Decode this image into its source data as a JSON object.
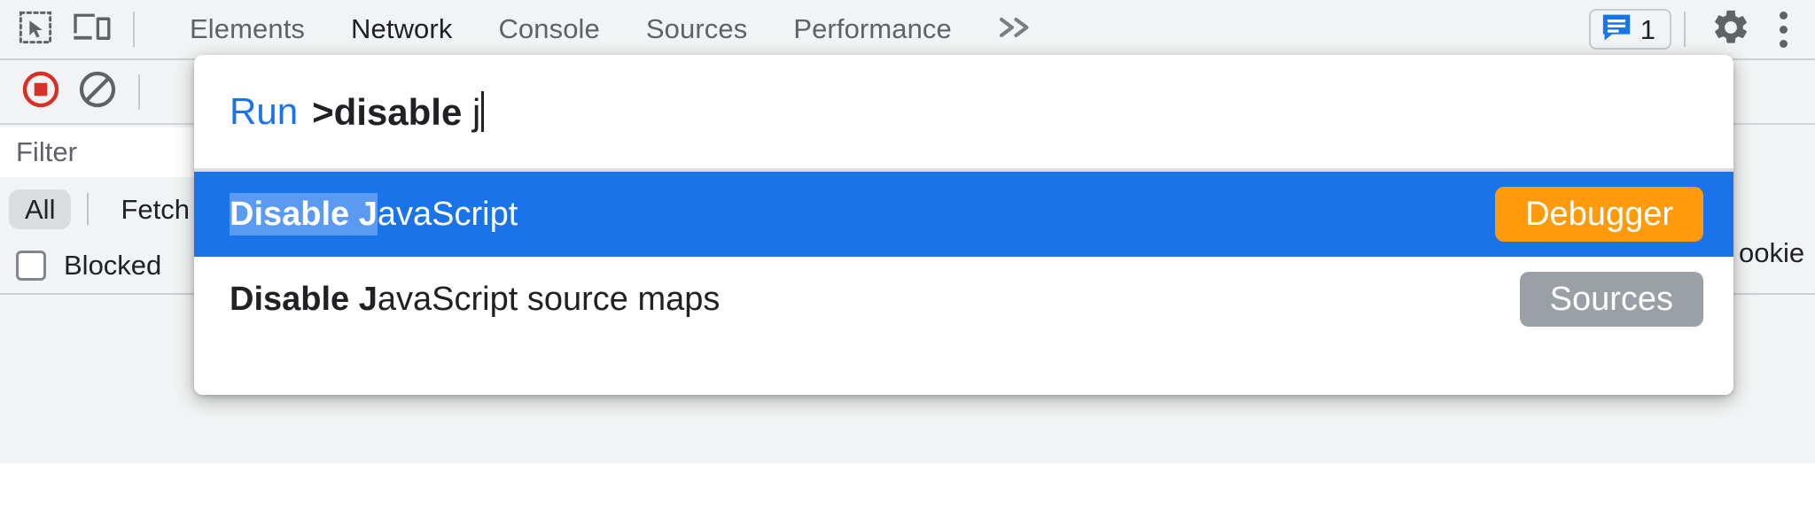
{
  "toolbar": {
    "icons": {
      "inspect": "inspect-element-icon",
      "device": "device-toolbar-icon",
      "overflow": "chevron-double-right-icon",
      "settings": "gear-icon",
      "more": "more-vertical-icon",
      "messages": "message-bubble-icon"
    },
    "tabs": [
      {
        "label": "Elements",
        "active": false
      },
      {
        "label": "Network",
        "active": true
      },
      {
        "label": "Console",
        "active": false
      },
      {
        "label": "Sources",
        "active": false
      },
      {
        "label": "Performance",
        "active": false
      }
    ],
    "overflow_label": "»",
    "message_count": "1"
  },
  "network": {
    "record_icon": "record-stop-icon",
    "clear_icon": "clear-network-log-icon",
    "filter_placeholder": "Filter",
    "type_chips": [
      {
        "label": "All",
        "selected": true
      },
      {
        "label": "Fetch",
        "selected": false
      }
    ],
    "blocked_label": "Blocked",
    "blocked_checked": false,
    "right_cut_label": "ookie"
  },
  "command_menu": {
    "prefix": "Run",
    "query_prefix": ">disable ",
    "query_typed": "j",
    "results": [
      {
        "match": "Disable J",
        "rest": "avaScript",
        "badge": "Debugger",
        "badge_color": "#FF9B0A",
        "selected": true
      },
      {
        "match": "Disable J",
        "rest": "avaScript source maps",
        "badge": "Sources",
        "badge_color": "#9AA0A6",
        "selected": false
      }
    ]
  },
  "colors": {
    "accent_blue": "#1A73E8",
    "toolbar_bg": "#F1F3F4",
    "highlight_blue": "#5B9AF2",
    "record_red": "#D93025"
  }
}
